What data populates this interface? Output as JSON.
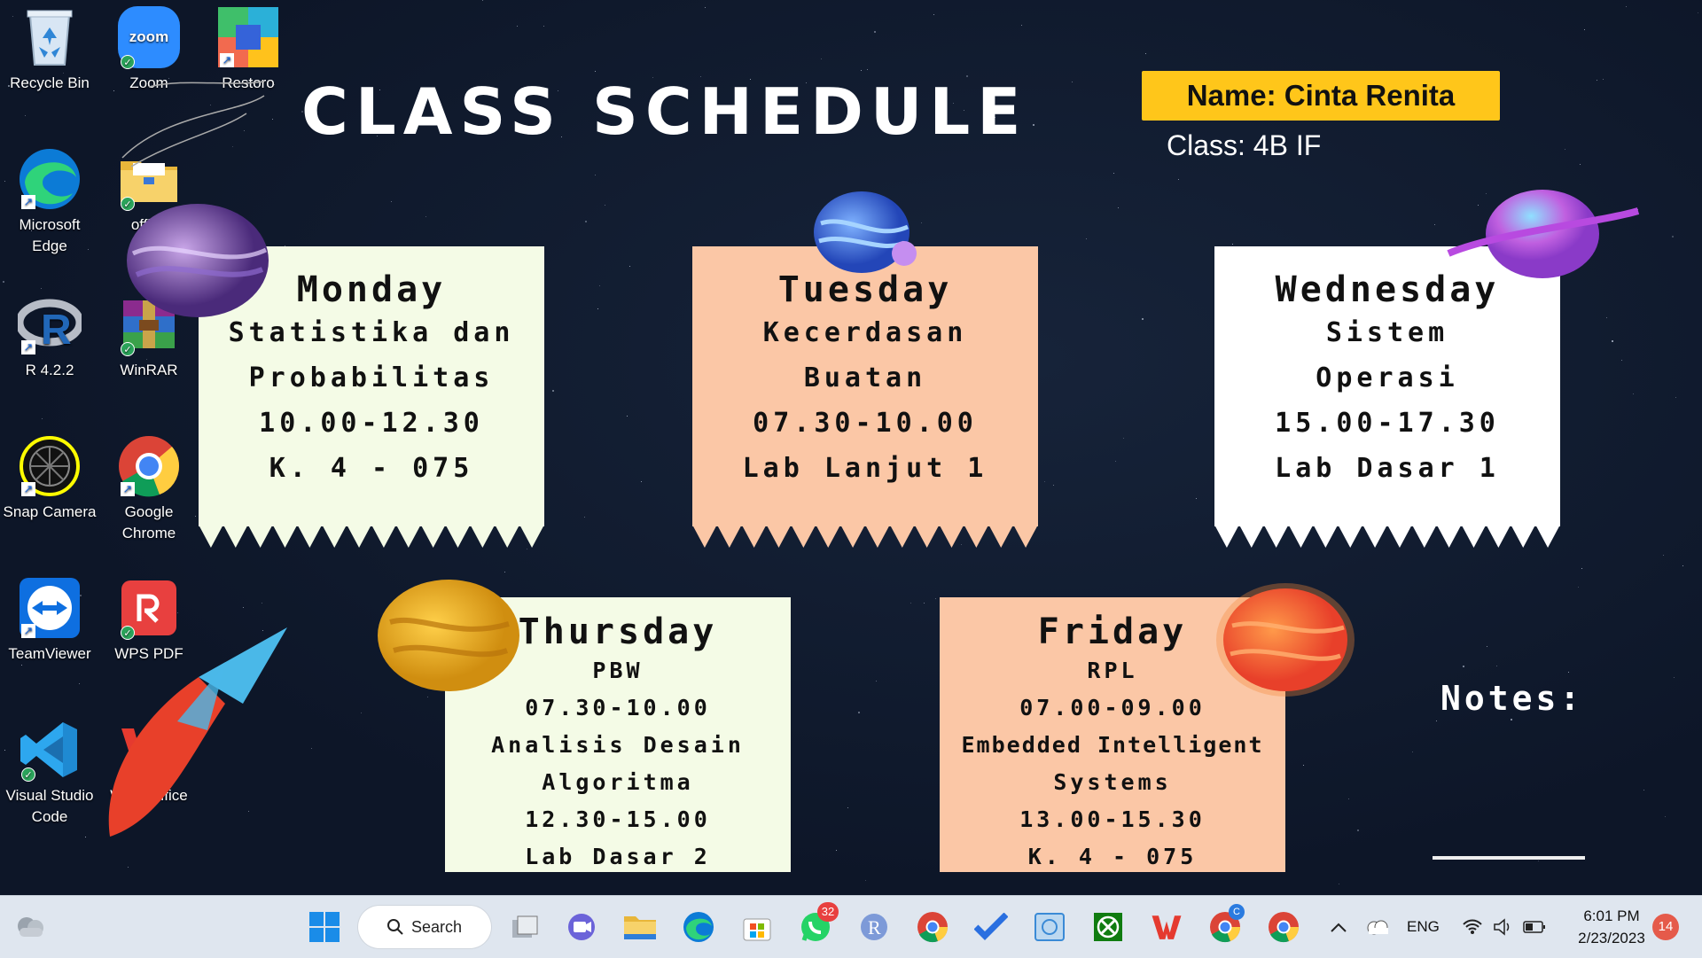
{
  "desktop": {
    "icons": [
      {
        "label": "Recycle Bin",
        "icon": "recycle-bin-icon"
      },
      {
        "label": "Zoom",
        "icon": "zoom-icon"
      },
      {
        "label": "Restoro",
        "icon": "restoro-icon"
      },
      {
        "label": "Microsoft Edge",
        "icon": "edge-icon"
      },
      {
        "label": "office",
        "icon": "folder-icon"
      },
      {
        "label": "R 4.2.2",
        "icon": "r-icon"
      },
      {
        "label": "WinRAR",
        "icon": "winrar-icon"
      },
      {
        "label": "Snap Camera",
        "icon": "snap-camera-icon"
      },
      {
        "label": "Google Chrome",
        "icon": "chrome-icon"
      },
      {
        "label": "TeamViewer",
        "icon": "teamviewer-icon"
      },
      {
        "label": "WPS PDF",
        "icon": "wps-pdf-icon"
      },
      {
        "label": "Visual Studio Code",
        "icon": "vscode-icon"
      },
      {
        "label": "WPS Office",
        "icon": "wps-office-icon"
      }
    ]
  },
  "wallpaper": {
    "title": "CLASS SCHEDULE",
    "name": "Name: Cinta Renita",
    "class": "Class: 4B IF",
    "notes_label": "Notes:",
    "days": [
      {
        "day": "Monday",
        "lines": [
          "Statistika dan",
          "Probabilitas",
          "10.00-12.30",
          "K. 4 - 075"
        ],
        "color": "#f4fbe6"
      },
      {
        "day": "Tuesday",
        "lines": [
          "Kecerdasan",
          "Buatan",
          "07.30-10.00",
          "Lab Lanjut 1"
        ],
        "color": "#fbc7a6"
      },
      {
        "day": "Wednesday",
        "lines": [
          "Sistem",
          "Operasi",
          "15.00-17.30",
          "Lab Dasar 1"
        ],
        "color": "#ffffff"
      },
      {
        "day": "Thursday",
        "lines": [
          "PBW",
          "07.30-10.00",
          "Analisis Desain",
          "Algoritma",
          "12.30-15.00",
          "Lab Dasar 2"
        ],
        "color": "#f4fbe6"
      },
      {
        "day": "Friday",
        "lines": [
          "RPL",
          "07.00-09.00",
          "Embedded Intelligent",
          "Systems",
          "13.00-15.30",
          "K. 4 - 075"
        ],
        "color": "#fbc7a6"
      }
    ]
  },
  "taskbar": {
    "search_label": "Search",
    "whatsapp_badge": "32",
    "chrome_badge": "C",
    "language": "ENG",
    "time": "6:01 PM",
    "date": "2/23/2023",
    "notification_count": "14"
  }
}
